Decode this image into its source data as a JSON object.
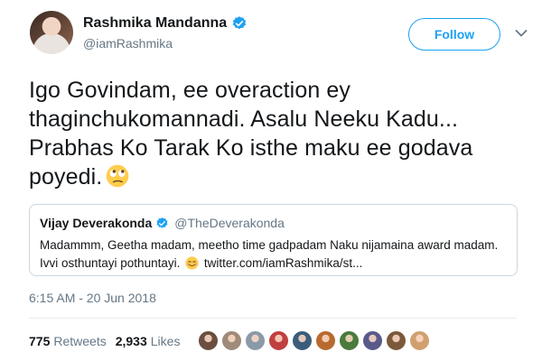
{
  "author": {
    "display_name": "Rashmika Mandanna",
    "handle": "@iamRashmika",
    "verified": true
  },
  "follow_label": "Follow",
  "tweet_text_lines": [
    "Igo Govindam, ee overaction ey",
    "thaginchukomannadi. Asalu Neeku Kadu...",
    "Prabhas Ko Tarak Ko isthe maku ee godava",
    "poyedi."
  ],
  "tweet_emoji": "face-with-rolling-eyes",
  "quote": {
    "display_name": "Vijay Deverakonda",
    "handle": "@TheDeverakonda",
    "verified": true,
    "line1": "Madammm, Geetha madam, meetho time gadpadam Naku nijamaina award madam.",
    "line2_before_emoji": "Ivvi osthuntayi pothuntayi.",
    "emoji": "smiling-face-with-smiling-eyes",
    "line2_link": "twitter.com/iamRashmika/st..."
  },
  "timestamp": "6:15 AM - 20 Jun 2018",
  "stats": {
    "retweets_count": "775",
    "retweets_label": "Retweets",
    "likes_count": "2,933",
    "likes_label": "Likes"
  },
  "colors": {
    "accent": "#1da1f2",
    "secondary_text": "#657786",
    "border": "#ccd6dd",
    "face_colors": [
      "#6b4e3f",
      "#a08a7a",
      "#8a9aa8",
      "#c04040",
      "#3b5d7a",
      "#b86a30",
      "#4a7a3e",
      "#5a5a8a",
      "#7a5a3a",
      "#d0a070"
    ]
  }
}
